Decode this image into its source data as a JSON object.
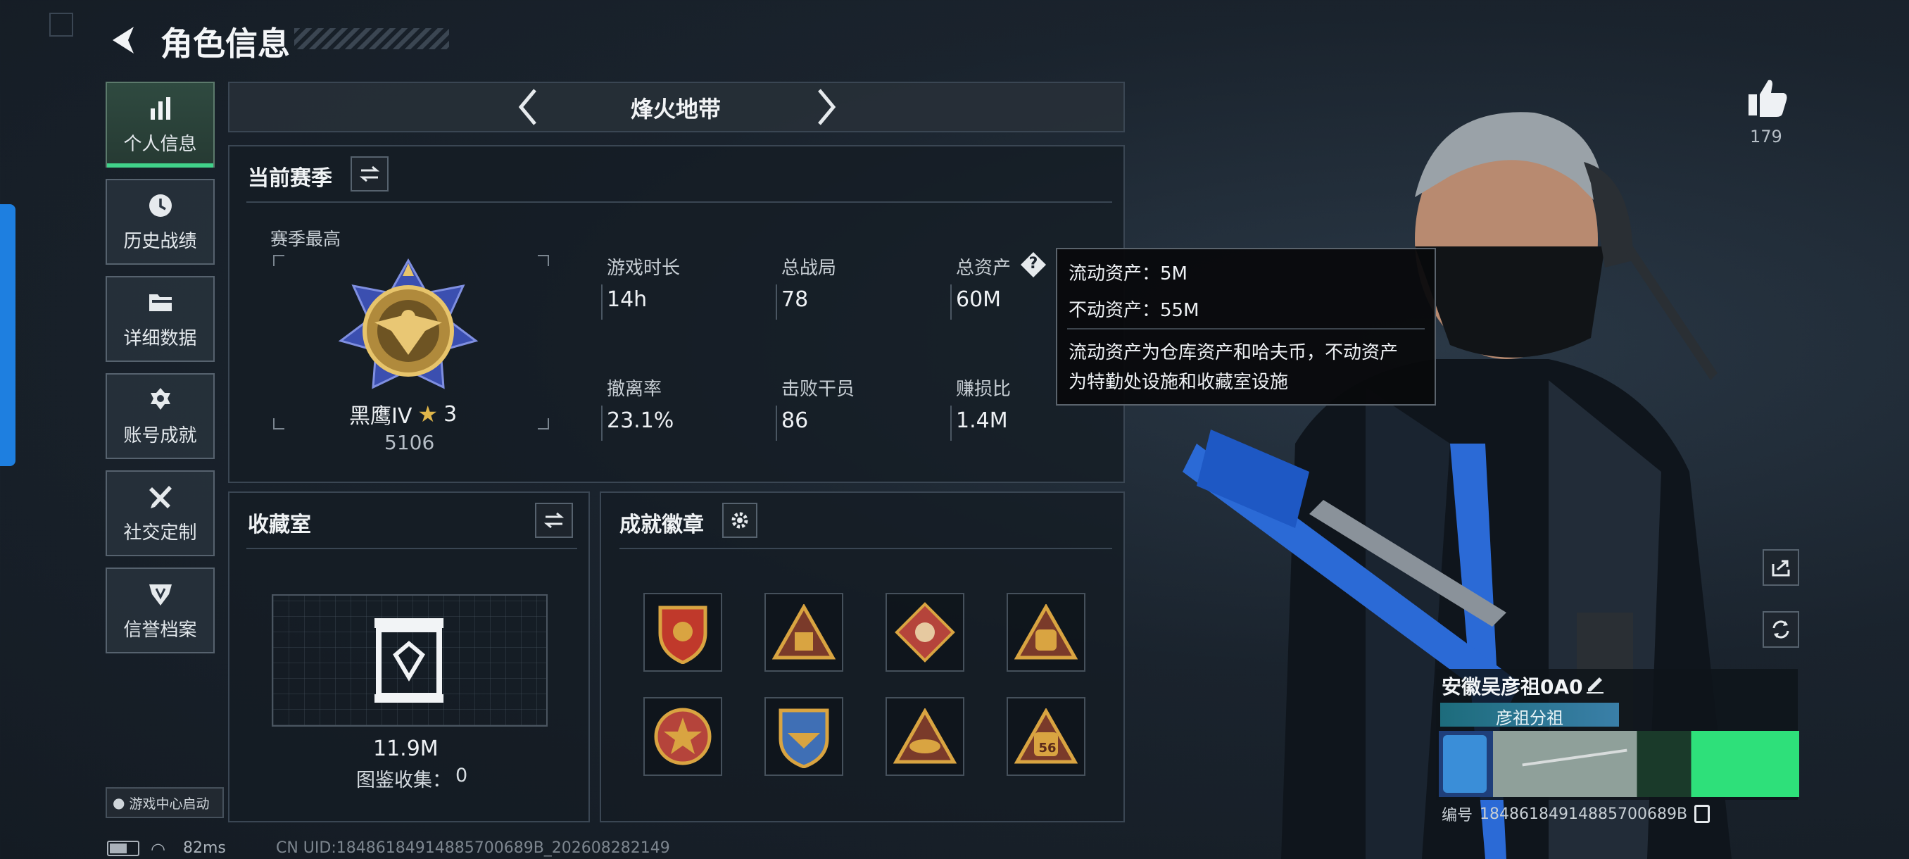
{
  "header": {
    "title": "角色信息"
  },
  "nav": {
    "items": [
      {
        "label": "个人信息",
        "icon": "bar-chart-icon",
        "active": true
      },
      {
        "label": "历史战绩",
        "icon": "history-clock-icon"
      },
      {
        "label": "详细数据",
        "icon": "folder-icon"
      },
      {
        "label": "账号成就",
        "icon": "achievement-icon"
      },
      {
        "label": "社交定制",
        "icon": "tools-icon"
      },
      {
        "label": "信誉档案",
        "icon": "credit-shield-icon"
      }
    ],
    "game_center_label": "游戏中心启动"
  },
  "mode_selector": {
    "label": "烽火地带"
  },
  "season": {
    "title": "当前赛季",
    "highest_label": "赛季最高",
    "rank_name": "黑鹰IV",
    "rank_stars": "3",
    "rank_score": "5106",
    "stats": [
      {
        "label": "游戏时长",
        "value": "14h"
      },
      {
        "label": "总战局",
        "value": "78"
      },
      {
        "label": "总资产",
        "value": "60M"
      },
      {
        "label": "撤离率",
        "value": "23.1%"
      },
      {
        "label": "击败干员",
        "value": "86"
      },
      {
        "label": "赚损比",
        "value": "1.4M"
      }
    ],
    "help_symbol": "?"
  },
  "tooltip": {
    "liquid": "流动资产：5M",
    "fixed": "不动资产：55M",
    "desc_line1": "流动资产为仓库资产和哈夫币，不动资产",
    "desc_line2": "为特勤处设施和收藏室设施"
  },
  "collection": {
    "title": "收藏室",
    "value": "11.9M",
    "catalog_label": "图鉴收集：",
    "catalog_count": "0"
  },
  "achievements": {
    "title": "成就徽章",
    "badges": [
      {
        "icon": "shield-badge-icon",
        "color": "#c0392b"
      },
      {
        "icon": "pyramid-badge-icon",
        "color": "#d9a441"
      },
      {
        "icon": "diamond-badge-icon",
        "color": "#b5443b"
      },
      {
        "icon": "bag-badge-icon",
        "color": "#d9a441"
      },
      {
        "icon": "star-shield-badge-icon",
        "color": "#b5443b"
      },
      {
        "icon": "wings-badge-icon",
        "color": "#3f6fb5"
      },
      {
        "icon": "hat-badge-icon",
        "color": "#d9a441"
      },
      {
        "icon": "bag-56-badge-icon",
        "color": "#d9a441",
        "label": "56"
      }
    ]
  },
  "social": {
    "likes": "179"
  },
  "player": {
    "name": "安徽吴彦祖0A0",
    "tag": "彦祖分祖",
    "id_label": "编号",
    "id_value": "18486184914885700689B"
  },
  "status_bar": {
    "ping": "82ms",
    "uid": "CN UID:18486184914885700689B_202608282149"
  },
  "colors": {
    "accent_green": "#41d28a",
    "tooltip_bg": "#080a0c",
    "blue_tab": "#1e7fe0"
  }
}
